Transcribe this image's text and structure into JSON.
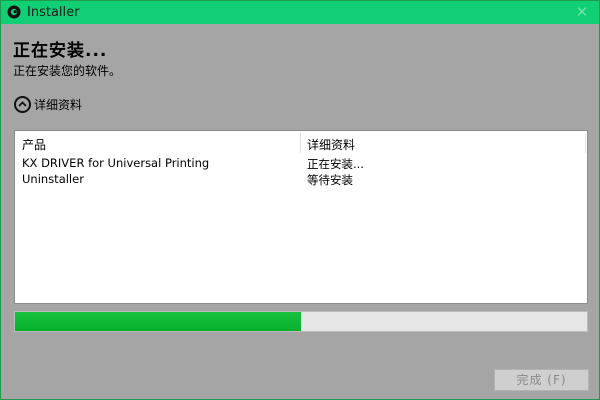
{
  "window": {
    "title": "Installer",
    "close_glyph": "✕"
  },
  "header": {
    "heading": "正在安装...",
    "subheading": "正在安装您的软件。"
  },
  "details_toggle": {
    "label": "详细资料",
    "icon": "chevron-up-icon"
  },
  "list": {
    "columns": [
      "产品",
      "详细资料"
    ],
    "rows": [
      {
        "product": "KX DRIVER for Universal Printing",
        "status": "正在安装..."
      },
      {
        "product": "Uninstaller",
        "status": "等待安装"
      }
    ]
  },
  "progress": {
    "fraction": 0.5
  },
  "footer": {
    "finish_label": "完成 (F)"
  },
  "colors": {
    "titlebar": "#10cf74",
    "window_bg": "#a5a5a5",
    "progress_fill": "#06b02b"
  }
}
